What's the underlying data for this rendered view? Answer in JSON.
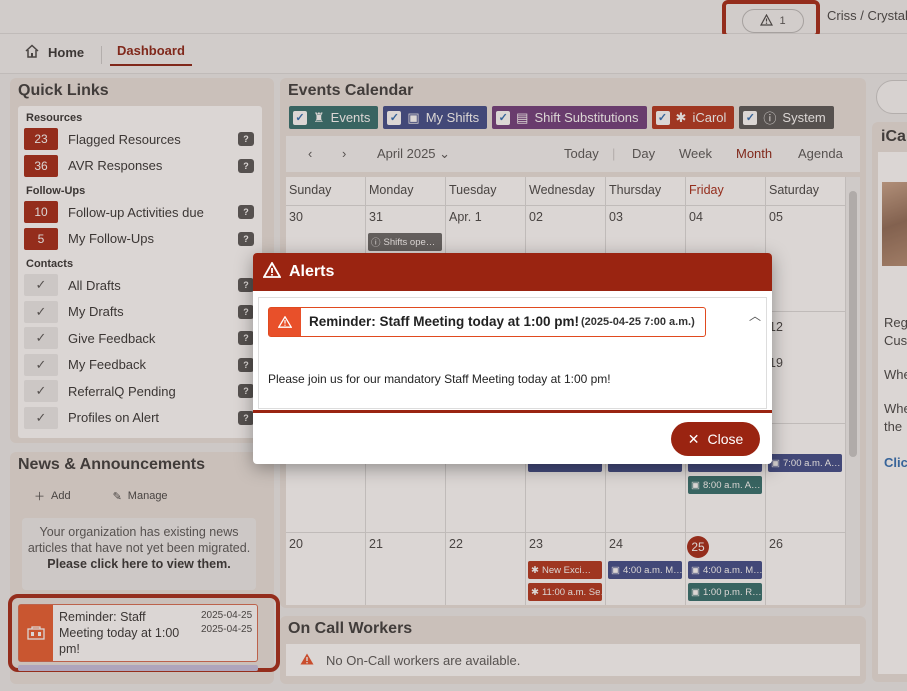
{
  "topbar": {
    "alert_count": "1",
    "user": "Criss / Crystal"
  },
  "nav": {
    "home": "Home",
    "dashboard": "Dashboard"
  },
  "quick_links": {
    "title": "Quick Links",
    "resources_heading": "Resources",
    "resources": [
      {
        "count": "23",
        "label": "Flagged Resources"
      },
      {
        "count": "36",
        "label": "AVR Responses"
      }
    ],
    "followups_heading": "Follow-Ups",
    "followups": [
      {
        "count": "10",
        "label": "Follow-up Activities due"
      },
      {
        "count": "5",
        "label": "My Follow-Ups"
      }
    ],
    "contacts_heading": "Contacts",
    "contacts": [
      {
        "label": "All Drafts"
      },
      {
        "label": "My Drafts"
      },
      {
        "label": "Give Feedback"
      },
      {
        "label": "My Feedback"
      },
      {
        "label": "ReferralQ Pending"
      },
      {
        "label": "Profiles on Alert"
      }
    ],
    "help_glyph": "?"
  },
  "news": {
    "title": "News & Announcements",
    "add": "Add",
    "manage": "Manage",
    "migration_msg": "Your organization has existing news articles that have not yet been migrated.",
    "migration_link": "Please click here to view them.",
    "item": {
      "title": "Reminder: Staff Meeting today at 1:00 pm!",
      "date1": "2025-04-25",
      "date2": "2025-04-25"
    }
  },
  "calendar": {
    "title": "Events Calendar",
    "filters": [
      {
        "label": "Events",
        "color": "#2f6e6c"
      },
      {
        "label": "My Shifts",
        "color": "#3b4a8a"
      },
      {
        "label": "Shift Substitutions",
        "color": "#6e3a7c"
      },
      {
        "label": "iCarol",
        "color": "#b2331a"
      },
      {
        "label": "System",
        "color": "#555555"
      }
    ],
    "month": "April 2025",
    "views": {
      "today": "Today",
      "day": "Day",
      "week": "Week",
      "month": "Month",
      "agenda": "Agenda"
    },
    "weekdays": [
      "Sunday",
      "Monday",
      "Tuesday",
      "Wednesday",
      "Thursday",
      "Friday",
      "Saturday"
    ],
    "weeks": [
      [
        "30",
        "31",
        "Apr. 1",
        "02",
        "03",
        "04",
        "05"
      ],
      [
        "",
        "",
        "",
        "",
        "",
        "",
        "12"
      ],
      [
        "",
        "",
        "",
        "",
        "",
        "",
        "19"
      ],
      [
        "20",
        "21",
        "22",
        "23",
        "24",
        "25",
        "26"
      ]
    ],
    "events": {
      "shifts_open": "Shifts ope…",
      "w3_sat": "7:00 a.m. A…",
      "w3_fri": "8:00 a.m. A…",
      "w4_wed1": "New Exci…",
      "w4_wed2": "11:00 a.m. Se…",
      "w4_thu": "4:00 a.m. M…",
      "w4_fri1": "4:00 a.m. M…",
      "w4_fri2": "1:00 p.m. R…"
    },
    "colors": {
      "shift": "#3b4a8a",
      "event": "#2f6e6c",
      "icarol": "#b2331a",
      "system": "#666666"
    }
  },
  "oncall": {
    "title": "On Call Workers",
    "empty": "No On-Call workers are available."
  },
  "right_panel": {
    "title": "iCarol",
    "lines": [
      "Regards,",
      "Customer",
      "When",
      "When",
      "the",
      "Click"
    ]
  },
  "modal": {
    "title": "Alerts",
    "alert_title": "Reminder: Staff Meeting today at 1:00 pm!",
    "alert_date": "(2025-04-25 7:00 a.m.)",
    "alert_body": "Please join us for our mandatory Staff Meeting today at 1:00 pm!",
    "close": "Close"
  }
}
